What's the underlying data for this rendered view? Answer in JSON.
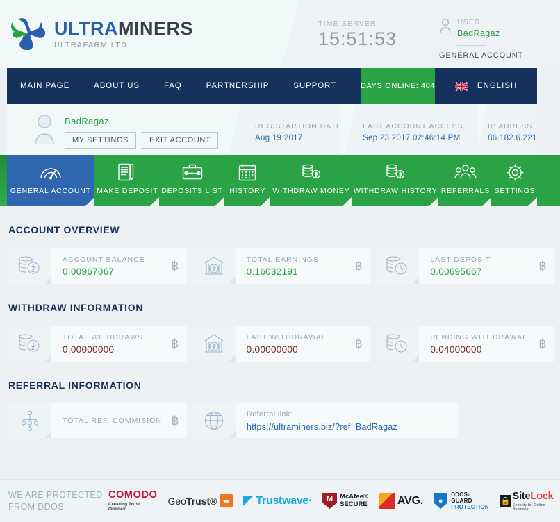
{
  "brand": {
    "name_part1": "ULTRA",
    "name_part2": "MINERS",
    "subtitle": "ULTRAFARM LTD",
    "logo_icon": "x-cross-logo-icon"
  },
  "header": {
    "time_label": "TIME SERVER",
    "time_value": "15:51:53",
    "user_label": "USER",
    "user_name": "BadRagaz",
    "account_type": "GENERAL ACCOUNT"
  },
  "nav": {
    "items": [
      {
        "label": "MAIN PAGE"
      },
      {
        "label": "ABOUT US"
      },
      {
        "label": "FAQ"
      },
      {
        "label": "PARTNERSHIP"
      },
      {
        "label": "SUPPORT"
      }
    ],
    "days_online": "DAYS ONLINE: 404",
    "language": "ENGLISH",
    "flag_icon": "uk-flag-icon"
  },
  "strip": {
    "username": "BadRagaz",
    "avatar_icon": "user-avatar-icon",
    "my_settings": "MY SETTINGS",
    "exit_account": "EXIT ACCOUNT",
    "fields": [
      {
        "label": "REGISTARTION DATE",
        "value": "Aug 19 2017"
      },
      {
        "label": "LAST ACCOUNT ACCESS",
        "value": "Sep 23  2017  02:46:14 PM"
      },
      {
        "label": "IP ADRESS",
        "value": "86.182.6.221"
      }
    ]
  },
  "tabs": [
    {
      "label": "GENERAL ACCOUNT",
      "icon": "gauge-icon",
      "active": true
    },
    {
      "label": "MAKE DEPOSIT",
      "icon": "document-pen-icon",
      "active": false
    },
    {
      "label": "DEPOSITS LIST",
      "icon": "briefcase-icon",
      "active": false
    },
    {
      "label": "HISTORY",
      "icon": "calendar-icon",
      "active": false
    },
    {
      "label": "WITHDRAW MONEY",
      "icon": "coins-icon",
      "active": false
    },
    {
      "label": "WITHDRAW HISTORY",
      "icon": "coins-icon",
      "active": false
    },
    {
      "label": "REFERRALS",
      "icon": "people-group-icon",
      "active": false
    },
    {
      "label": "SETTINGS",
      "icon": "gear-icon",
      "active": false
    }
  ],
  "sections": {
    "account_overview": {
      "title": "ACCOUNT OVERVIEW",
      "cards": [
        {
          "label": "ACCOUNT BALANCE",
          "value": "0.00967067",
          "currency": "฿",
          "icon": "coin-stack-bitcoin-icon"
        },
        {
          "label": "TOTAL EARNINGS",
          "value": "0.16032191",
          "currency": "฿",
          "icon": "bank-bitcoin-icon"
        },
        {
          "label": "LAST DEPOSIT",
          "value": "0.00695667",
          "currency": "฿",
          "icon": "coins-clock-icon"
        }
      ]
    },
    "withdraw_information": {
      "title": "WITHDRAW INFORMATION",
      "cards": [
        {
          "label": "TOTAL WITHDRAWS",
          "value": "0.00000000",
          "currency": "฿",
          "icon": "coin-stack-bitcoin-icon"
        },
        {
          "label": "LAST WITHDRAWAL",
          "value": "0.00000000",
          "currency": "฿",
          "icon": "bank-bitcoin-icon"
        },
        {
          "label": "PENDING WITHDRAWAL",
          "value": "0.04000000",
          "currency": "฿",
          "icon": "coins-clock-icon"
        }
      ]
    },
    "referral_information": {
      "title": "REFERRAL INFORMATION",
      "commission": {
        "label": "TOTAL REF. COMMISION",
        "currency": "฿",
        "icon": "network-node-icon"
      },
      "link": {
        "label": "Referral link:",
        "value": "https://ultraminers.biz/?ref=BadRagaz",
        "icon": "globe-icon"
      }
    }
  },
  "footer": {
    "protected_line1": "WE ARE PROTECTED",
    "protected_line2": "FROM DDOS",
    "badges": [
      {
        "name": "comodo",
        "t1": "COMODO",
        "t2": "Creating Trust Online®"
      },
      {
        "name": "geotrust",
        "t1": "Geo",
        "t2": "Trust®"
      },
      {
        "name": "trustwave",
        "t1": "Trustwave·"
      },
      {
        "name": "mcafee",
        "t1": "McAfee®",
        "t2": "SECURE"
      },
      {
        "name": "avg",
        "t1": "AVG."
      },
      {
        "name": "ddosguard",
        "t1": "DDOS-GUARD",
        "t2": "PROTECTION"
      },
      {
        "name": "sitelock",
        "t1": "Site",
        "t2": "Lock",
        "t3": "Security for Online Business"
      }
    ]
  },
  "colors": {
    "navy": "#15325c",
    "green": "#2aa346",
    "blue_active": "#2f66ae",
    "value_green": "#27a03f",
    "value_red": "#7c2020",
    "link_blue": "#2a6aaa"
  }
}
